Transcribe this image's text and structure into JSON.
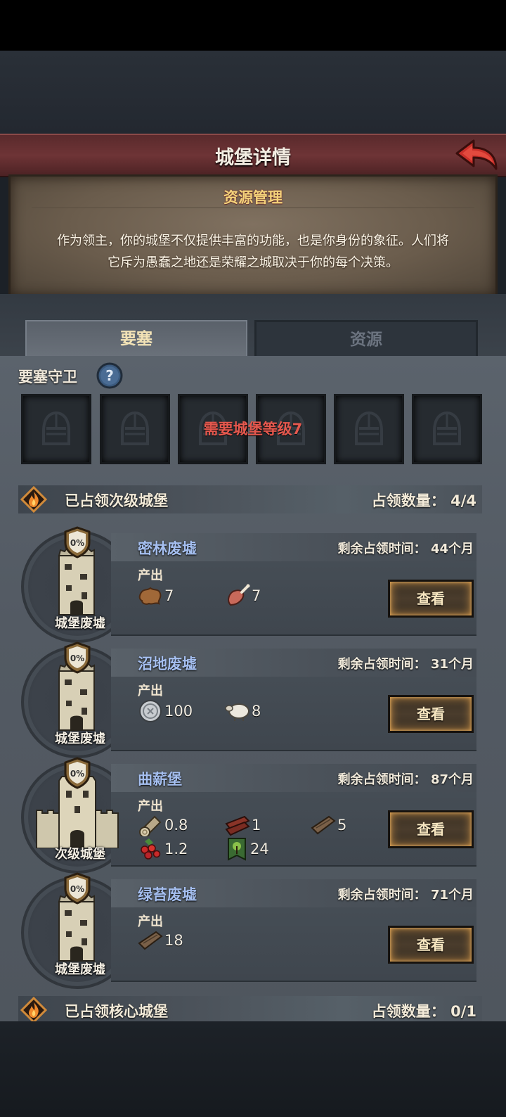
{
  "header": {
    "title": "城堡详情"
  },
  "intro": {
    "title": "资源管理",
    "desc_line1": "作为领主，你的城堡不仅提供丰富的功能，也是你身份的象征。人们将",
    "desc_line2": "它斥为愚蠢之地还是荣耀之城取决于你的每个决策。"
  },
  "tabs": {
    "fortress": "要塞",
    "resource": "资源"
  },
  "guard": {
    "label": "要塞守卫",
    "notice": "需要城堡等级7"
  },
  "sub_section": {
    "title": "已占领次级城堡",
    "count_label": "占领数量：",
    "count": "4/4"
  },
  "core_section": {
    "title": "已占领核心城堡",
    "count_label": "占领数量：",
    "count": "0/1"
  },
  "cards": [
    {
      "name": "密林废墟",
      "remain_label": "剩余占领时间：",
      "remain_value": "44",
      "remain_unit": "个月",
      "produce_label": "产出",
      "type": "城堡废墟",
      "percent": "0%",
      "button": "查看",
      "resources": [
        {
          "icon": "leather-icon",
          "value": "7"
        },
        {
          "icon": "meat-icon",
          "value": "7"
        }
      ]
    },
    {
      "name": "沼地废墟",
      "remain_label": "剩余占领时间：",
      "remain_value": "31",
      "remain_unit": "个月",
      "produce_label": "产出",
      "type": "城堡废墟",
      "percent": "0%",
      "button": "查看",
      "resources": [
        {
          "icon": "silver-coin-icon",
          "value": "100"
        },
        {
          "icon": "sheep-icon",
          "value": "8"
        }
      ]
    },
    {
      "name": "曲薪堡",
      "remain_label": "剩余占领时间：",
      "remain_value": "87",
      "remain_unit": "个月",
      "produce_label": "产出",
      "type": "次级城堡",
      "percent": "0%",
      "button": "查看",
      "resources": [
        {
          "icon": "log-icon",
          "value": "0.8"
        },
        {
          "icon": "timber-icon",
          "value": "1"
        },
        {
          "icon": "plank-icon",
          "value": "5"
        },
        {
          "icon": "berries-icon",
          "value": "1.2"
        },
        {
          "icon": "tree-banner-icon",
          "value": "24"
        }
      ]
    },
    {
      "name": "绿苔废墟",
      "remain_label": "剩余占领时间：",
      "remain_value": "71",
      "remain_unit": "个月",
      "produce_label": "产出",
      "type": "城堡废墟",
      "percent": "0%",
      "button": "查看",
      "resources": [
        {
          "icon": "plank-icon",
          "value": "18"
        }
      ]
    }
  ],
  "colors": {
    "header_red": "#6e3436",
    "name_blue": "#a5bff0",
    "notice_red": "#e5584e",
    "parchment_title": "#f4d27a"
  }
}
